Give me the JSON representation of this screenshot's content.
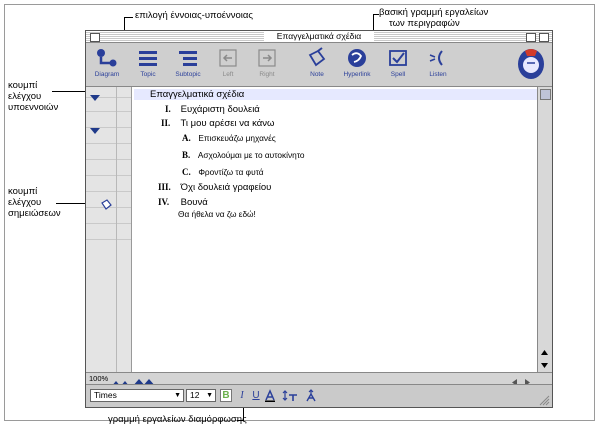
{
  "callouts": {
    "concept_subconcept": "επιλογή έννοιας-υποέννοιας",
    "main_toolbar_line1": "βασική γραμμή εργαλείων",
    "main_toolbar_line2": "των περιγραφών",
    "subconcept_button_line1": "κουμπί",
    "subconcept_button_line2": "ελέγχου",
    "subconcept_button_line3": "υποεννοιών",
    "notes_button_line1": "κουμπί",
    "notes_button_line2": "ελέγχου",
    "notes_button_line3": "σημειώσεων",
    "format_toolbar": "γραμμή εργαλείων διαμόρφωσης"
  },
  "window": {
    "title": "Επαγγελματικά σχέδια"
  },
  "toolbar": {
    "diagram": "Diagram",
    "topic": "Topic",
    "subtopic": "Subtopic",
    "left": "Left",
    "right": "Right",
    "note": "Note",
    "hyperlink": "Hyperlink",
    "spell": "Spell",
    "listen": "Listen"
  },
  "outline": {
    "title": "Επαγγελματικά σχέδια",
    "items": [
      {
        "num": "I.",
        "text": "Ευχάριστη δουλειά"
      },
      {
        "num": "II.",
        "text": "Τι μου αρέσει να κάνω"
      },
      {
        "num": "A.",
        "text": "Επισκευάζω μηχανές"
      },
      {
        "num": "B.",
        "text": "Ασχολούμαι με το αυτοκίνητο"
      },
      {
        "num": "C.",
        "text": "Φροντίζω τα φυτά"
      },
      {
        "num": "III.",
        "text": "Όχι δουλειά γραφείου"
      },
      {
        "num": "IV.",
        "text": "Βουνά"
      }
    ],
    "note": "Θα ήθελα να ζω εδώ!"
  },
  "statusbar": {
    "zoom": "100%"
  },
  "format": {
    "font": "Times",
    "size": "12",
    "bold": "B",
    "italic": "I",
    "underline": "U"
  },
  "colors": {
    "toolbar_icon": "#2a3f9a",
    "selection": "#e6e9ff",
    "bold_active": "#6ab04c"
  }
}
